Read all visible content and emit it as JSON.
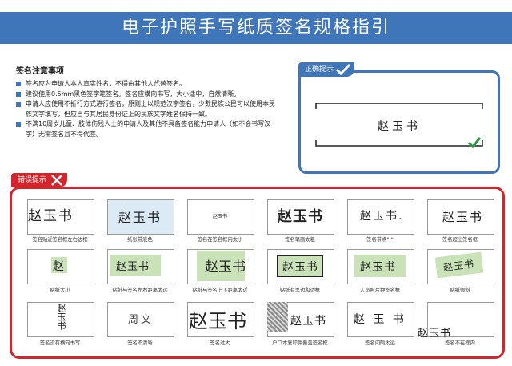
{
  "title": "电子护照手写纸质签名规格指引",
  "notes": {
    "heading": "签名注意事项",
    "items": [
      "签名应为申请人本人真实姓名，不得由其他人代替签名。",
      "建议使用0.5mm黑色签字笔签名。签名应横向书写，大小适中，自然清晰。",
      "申请人应使用不折行方式进行签名，原则上以规范汉字签名，少数民族公民可以使用本民族文字填写，但应当与其居民身份证上的民族文字姓名保持一致。",
      "不满10周岁儿童、肢体伤残人士的申请人及其他不具备签名能力申请人（如不会书写汉字）无需签名且不得代签。"
    ]
  },
  "correct": {
    "label": "正确提示",
    "sample": "赵玉书"
  },
  "wrong": {
    "label": "错误提示",
    "examples": [
      {
        "sig": "赵玉书",
        "caption": "签名贴近签名框左右边框"
      },
      {
        "sig": "赵玉书",
        "caption": "纸张带底色"
      },
      {
        "sig": "赵玉书",
        "caption": "签名在签名框内太小"
      },
      {
        "sig": "赵玉书",
        "caption": "签名笔画太粗"
      },
      {
        "sig": "赵玉书.",
        "caption": "签名带点“.”"
      },
      {
        "sig": "赵玉书",
        "caption": "签名超出签名框"
      },
      {
        "sig": "赵",
        "caption": "贴纸太小"
      },
      {
        "sig": "赵玉书",
        "caption": "贴纸与签名左右距离太远"
      },
      {
        "sig": "赵玉书",
        "caption": "贴纸与签名上下距离太近"
      },
      {
        "sig": "赵玉书",
        "caption": "贴纸有黑边和边框"
      },
      {
        "sig": "赵玉书",
        "caption": "人员照片押签名框"
      },
      {
        "sig": "赵玉书",
        "caption": "贴纸倾斜"
      },
      {
        "sig": "赵玉书",
        "caption": "签名没有横向书写"
      },
      {
        "sig": "周文",
        "caption": "签名不清晰"
      },
      {
        "sig": "赵玉书",
        "caption": "签名过大"
      },
      {
        "sig": "赵玉书",
        "caption": "户口本复印件覆盖签名框"
      },
      {
        "sig": "赵 玉 书",
        "caption": "签名间隔太远"
      },
      {
        "sig": "赵玉书",
        "caption": "签名不在框内"
      }
    ]
  },
  "colors": {
    "blue": "#3f76ba",
    "red": "#d3262c",
    "sticker_green": "#c9e2b8"
  }
}
